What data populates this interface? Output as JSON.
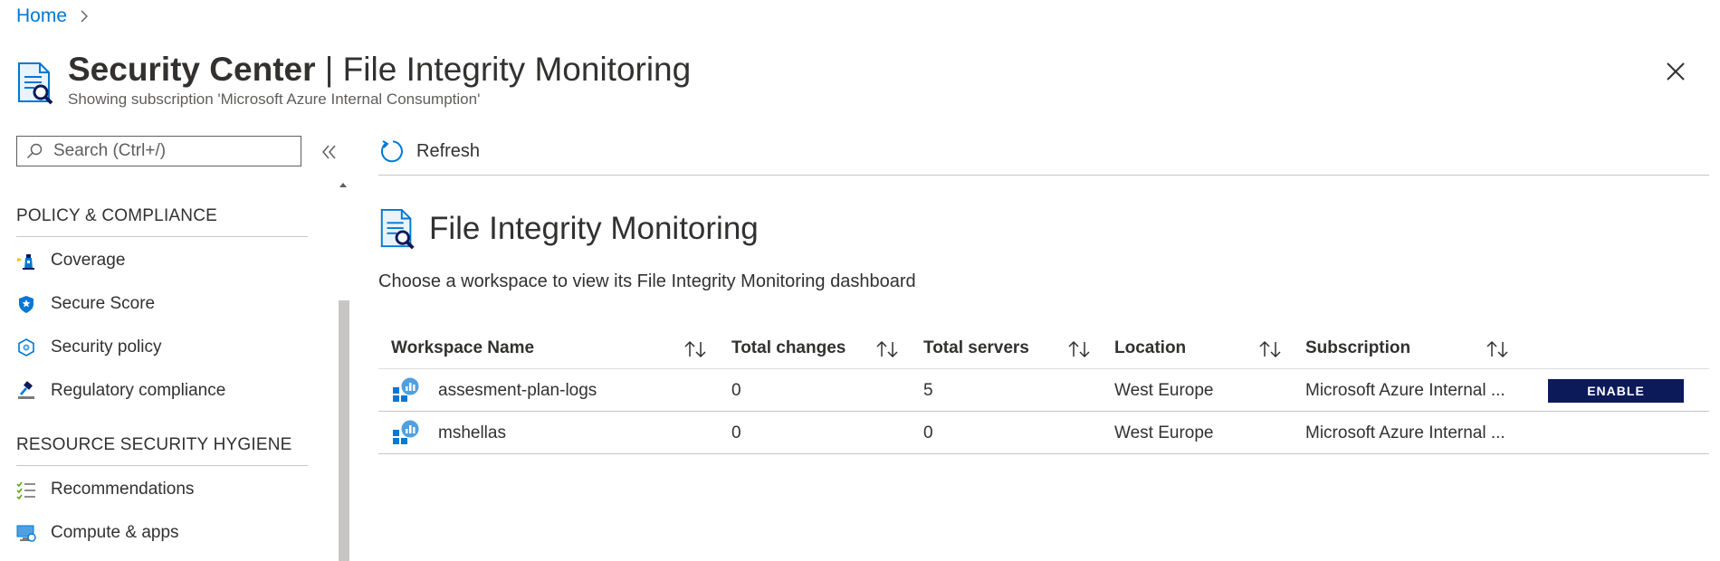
{
  "breadcrumb": {
    "home": "Home"
  },
  "header": {
    "title_bold": "Security Center",
    "title_rest": " | File Integrity Monitoring",
    "subtitle": "Showing subscription 'Microsoft Azure Internal Consumption'"
  },
  "nav": {
    "search_placeholder": "Search (Ctrl+/)",
    "sections": [
      {
        "title": "POLICY & COMPLIANCE",
        "items": [
          {
            "label": "Coverage",
            "icon": "lighthouse-icon"
          },
          {
            "label": "Secure Score",
            "icon": "shield-icon"
          },
          {
            "label": "Security policy",
            "icon": "policy-gear-icon"
          },
          {
            "label": "Regulatory compliance",
            "icon": "gavel-icon"
          }
        ]
      },
      {
        "title": "RESOURCE SECURITY HYGIENE",
        "items": [
          {
            "label": "Recommendations",
            "icon": "checklist-icon"
          },
          {
            "label": "Compute & apps",
            "icon": "monitor-icon"
          }
        ]
      }
    ]
  },
  "toolbar": {
    "refresh_label": "Refresh"
  },
  "content": {
    "title": "File Integrity Monitoring",
    "description": "Choose a workspace to view its File Integrity Monitoring dashboard"
  },
  "table": {
    "columns": [
      "Workspace Name",
      "Total changes",
      "Total servers",
      "Location",
      "Subscription"
    ],
    "rows": [
      {
        "name": "assesment-plan-logs",
        "changes": "0",
        "servers": "5",
        "location": "West Europe",
        "subscription": "Microsoft Azure Internal ...",
        "action": "ENABLE"
      },
      {
        "name": "mshellas",
        "changes": "0",
        "servers": "0",
        "location": "West Europe",
        "subscription": "Microsoft Azure Internal ...",
        "action": ""
      }
    ]
  },
  "colors": {
    "accent": "#0078d4",
    "enable_button": "#0c1a5a"
  }
}
